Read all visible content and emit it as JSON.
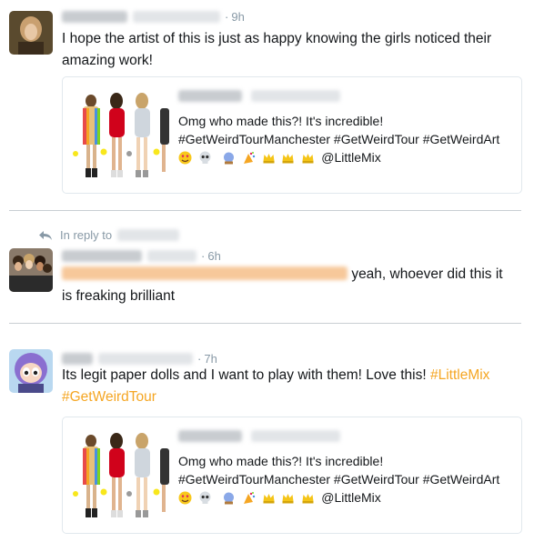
{
  "tweets": [
    {
      "time": "9h",
      "text": "I hope the artist of this is just as happy knowing the girls noticed their amazing work!",
      "card": {
        "line1": "Omg who made this?! It's incredible!",
        "line2": "#GetWeirdTourManchester #GetWeirdTour #GetWeirdArt",
        "mention": "@LittleMix"
      }
    },
    {
      "reply_label": "In reply to",
      "time": "6h",
      "text_suffix": "yeah, whoever did this it",
      "text_line2": "is freaking brilliant"
    },
    {
      "time": "7h",
      "text": "Its legit paper dolls and I want to play with them! Love this!",
      "hashtag1": "#LittleMix",
      "hashtag2": "#GetWeirdTour",
      "card": {
        "line1": "Omg who made this?! It's incredible!",
        "line2": "#GetWeirdTourManchester #GetWeirdTour #GetWeirdArt",
        "mention": "@LittleMix"
      }
    }
  ],
  "colors": {
    "accent": "#f5a623",
    "meta": "#8899a6",
    "border": "#e1e8ed"
  },
  "icons": [
    "reply-arrow-icon",
    "heart-eyes-emoji",
    "skull-emoji",
    "crystal-ball-emoji",
    "party-popper-emoji",
    "crown-emoji"
  ]
}
